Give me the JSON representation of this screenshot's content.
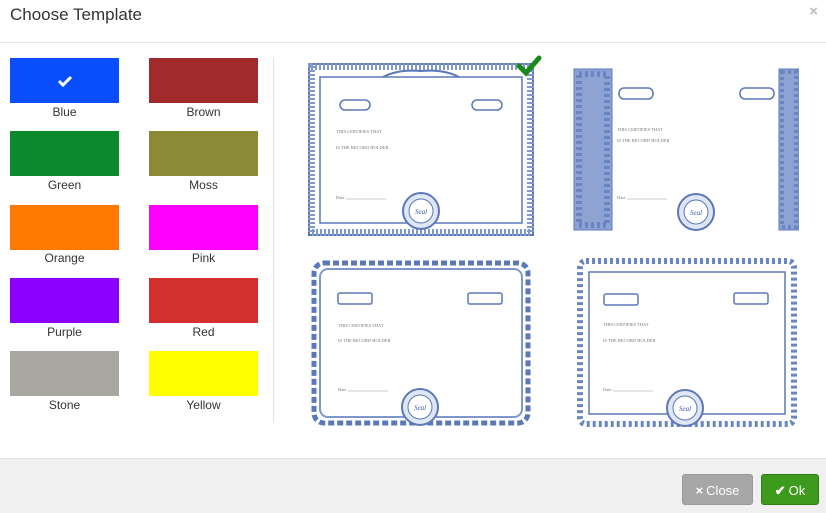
{
  "dialog": {
    "title": "Choose Template",
    "close_glyph": "×"
  },
  "colors": [
    {
      "label": "Blue",
      "hex": "#0a4dfc",
      "selected": true
    },
    {
      "label": "Brown",
      "hex": "#a12a2a"
    },
    {
      "label": "Green",
      "hex": "#0a8a2c"
    },
    {
      "label": "Moss",
      "hex": "#8b8b35"
    },
    {
      "label": "Orange",
      "hex": "#ff7a00"
    },
    {
      "label": "Pink",
      "hex": "#ff00ff"
    },
    {
      "label": "Purple",
      "hex": "#8b00ff"
    },
    {
      "label": "Red",
      "hex": "#d3302f"
    },
    {
      "label": "Stone",
      "hex": "#a8a8a0"
    },
    {
      "label": "Yellow",
      "hex": "#ffff00"
    }
  ],
  "templates": [
    {
      "name": "certificate-template-1",
      "selected": true
    },
    {
      "name": "certificate-template-2"
    },
    {
      "name": "certificate-template-3"
    },
    {
      "name": "certificate-template-4"
    }
  ],
  "certificate_text": {
    "line1": "THIS CERTIFIES THAT",
    "line2": "IS THE RECORD HOLDER",
    "date": "Date",
    "seal": "Seal"
  },
  "footer": {
    "close_label": "Close",
    "close_icon": "×",
    "ok_label": "Ok",
    "ok_icon": "✔"
  },
  "accent_colors": {
    "ok_green": "#3e9a1d",
    "check_green": "#1a8a1a",
    "border_blue": "#5b79b8"
  }
}
